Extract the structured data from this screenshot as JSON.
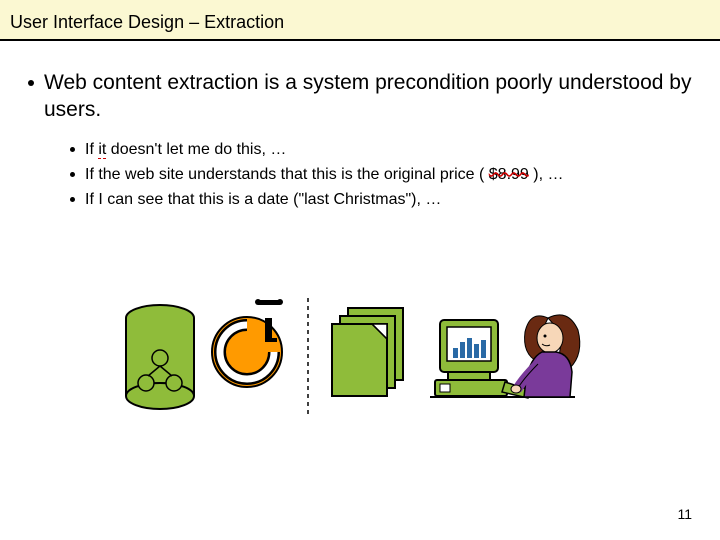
{
  "title": "User Interface Design – Extraction",
  "mainPoint": "Web content extraction is a system precondition poorly understood by users.",
  "sub": {
    "a_pre": "If ",
    "a_it": "it",
    "a_post": " doesn't let me do this, …",
    "b_pre": "If the web site understands that this is the original price ( ",
    "b_price": "$8.99",
    "b_post": " ), …",
    "c": "If I can see that this is a date (\"last Christmas\"), …"
  },
  "pageNumber": "11"
}
